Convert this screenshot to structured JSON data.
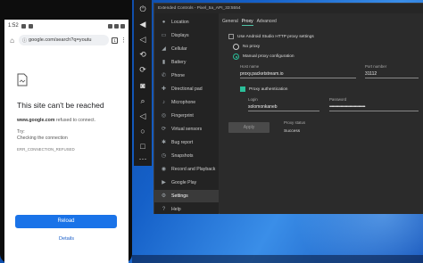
{
  "phone": {
    "status": {
      "time": "1:52"
    },
    "url": "google.com/search?q=youtu",
    "tab_count": "1",
    "error": {
      "title": "This site can't be reached",
      "host": "www.google.com",
      "sub_rest": " refused to connect.",
      "try": "Try:",
      "checking": "Checking the connection",
      "code": "ERR_CONNECTION_REFUSED"
    },
    "reload_label": "Reload",
    "details_label": "Details"
  },
  "toolbar": {
    "icons": [
      "power-icon",
      "volume-up-icon",
      "volume-down-icon",
      "rotate-left-icon",
      "rotate-right-icon",
      "camera-icon",
      "zoom-icon",
      "back-icon",
      "home-icon",
      "overview-icon",
      "more-icon"
    ]
  },
  "extended": {
    "title": "Extended Controls - Pixel_5a_API_33:5554",
    "nav": [
      {
        "label": "Location",
        "icon": "location-icon"
      },
      {
        "label": "Displays",
        "icon": "display-icon"
      },
      {
        "label": "Cellular",
        "icon": "cellular-icon"
      },
      {
        "label": "Battery",
        "icon": "battery-icon"
      },
      {
        "label": "Phone",
        "icon": "phone-icon"
      },
      {
        "label": "Directional pad",
        "icon": "dpad-icon"
      },
      {
        "label": "Microphone",
        "icon": "microphone-icon"
      },
      {
        "label": "Fingerprint",
        "icon": "fingerprint-icon"
      },
      {
        "label": "Virtual sensors",
        "icon": "sensors-icon"
      },
      {
        "label": "Bug report",
        "icon": "bug-icon"
      },
      {
        "label": "Snapshots",
        "icon": "snapshot-icon"
      },
      {
        "label": "Record and Playback",
        "icon": "record-icon"
      },
      {
        "label": "Google Play",
        "icon": "play-icon"
      },
      {
        "label": "Settings",
        "icon": "settings-icon"
      },
      {
        "label": "Help",
        "icon": "help-icon"
      }
    ],
    "tabs": {
      "general": "General",
      "proxy": "Proxy",
      "advanced": "Advanced"
    },
    "proxy": {
      "use_studio_label": "Use Android Studio HTTP proxy settings",
      "no_proxy_label": "No proxy",
      "manual_label": "Manual proxy configuration",
      "host_label": "Host name",
      "host_value": "proxy.packetstream.io",
      "port_label": "Port number",
      "port_value": "31112",
      "auth_label": "Proxy authentication",
      "login_label": "Login",
      "login_value": "solomonkaneb",
      "password_label": "Password",
      "password_value": "••••••••••••••••••••••••••••••••",
      "apply_label": "Apply",
      "status_label": "Proxy status",
      "status_value": "Success"
    }
  }
}
